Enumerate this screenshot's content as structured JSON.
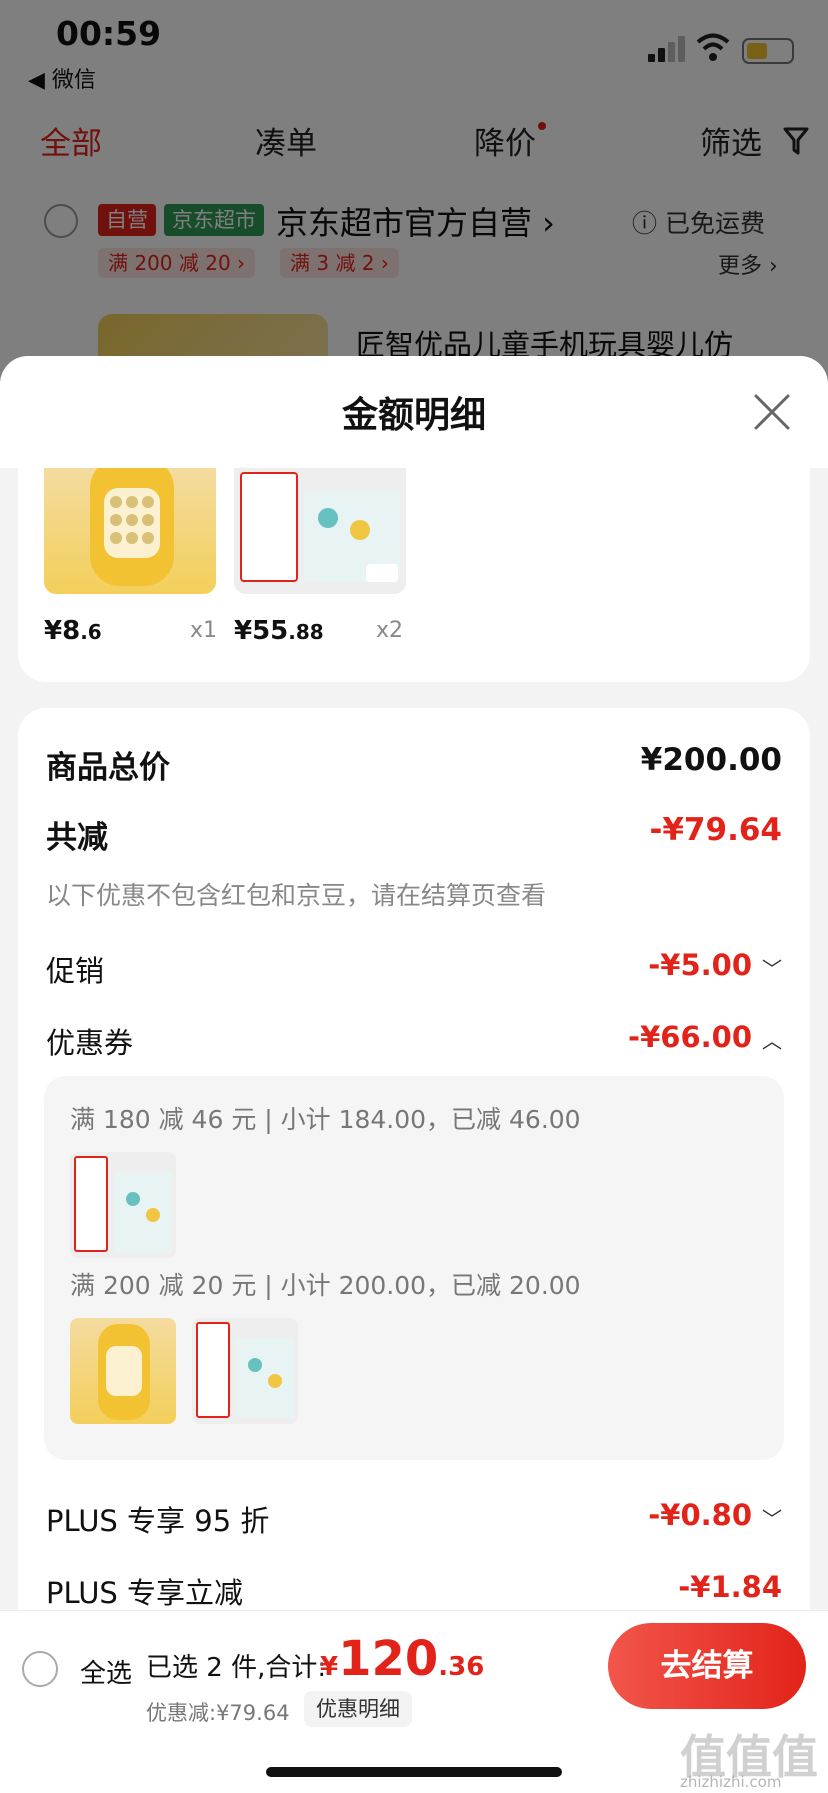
{
  "status_bar": {
    "time": "00:59",
    "back_label": "◀ 微信"
  },
  "top_tabs": [
    {
      "label": "全部",
      "active": true
    },
    {
      "label": "凑单",
      "active": false
    },
    {
      "label": "降价",
      "active": false,
      "dot": true
    },
    {
      "label": "筛选",
      "active": false
    }
  ],
  "store": {
    "tag_self": "自营",
    "tag_market": "京东超市",
    "name": "京东超市官方自营 ›",
    "free_shipping": "ⓘ 已免运费",
    "promos": [
      "满 200 减 20 ›",
      "满 3 减 2 ›"
    ],
    "more": "更多 ›"
  },
  "bg_product": {
    "title": "匠智优品儿童手机玩具婴儿仿"
  },
  "sheet": {
    "title": "金额明细",
    "products": [
      {
        "price_int": "¥8",
        "price_dec": ".6",
        "qty": "x1"
      },
      {
        "price_int": "¥55",
        "price_dec": ".88",
        "qty": "x2"
      }
    ],
    "summary": {
      "goods_total_label": "商品总价",
      "goods_total_value": "¥200.00",
      "reduce_label": "共减",
      "reduce_value": "-¥79.64",
      "note": "以下优惠不包含红包和京豆，请在结算页查看",
      "promo_label": "促销",
      "promo_value": "-¥5.00",
      "coupon_label": "优惠券",
      "coupon_value": "-¥66.00",
      "coupon_lines": [
        "满 180 减 46 元 | 小计 184.00，已减 46.00",
        "满 200 减 20 元 | 小计 200.00，已减 20.00"
      ],
      "plus95_label": "PLUS 专享 95 折",
      "plus95_value": "-¥0.80",
      "plus_cut_label": "PLUS 专享立减",
      "plus_cut_value": "-¥1.84"
    }
  },
  "bottom_bar": {
    "select_all": "全选",
    "selected_count": "已选 2 件,合计:",
    "total_currency": "¥",
    "total_int": "120",
    "total_dec": ".36",
    "discount": "优惠减:¥79.64",
    "detail_chip": "优惠明细",
    "checkout": "去结算"
  },
  "watermark": {
    "text": "值值值",
    "sub": "zhizhizhi.com"
  },
  "colors": {
    "accent": "#e2231a",
    "sheet_bg": "#f3f3f3"
  }
}
